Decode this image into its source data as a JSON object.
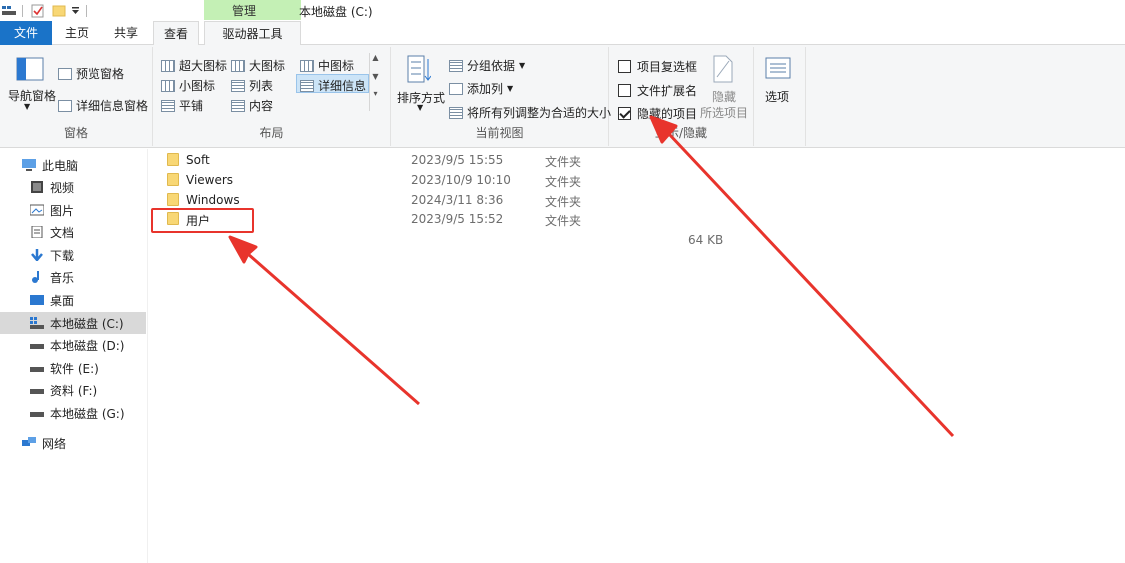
{
  "window": {
    "title": "本地磁盘 (C:)",
    "context_group_label": "管理"
  },
  "tabs": [
    {
      "label": "文件"
    },
    {
      "label": "主页"
    },
    {
      "label": "共享"
    },
    {
      "label": "查看"
    },
    {
      "label": "驱动器工具"
    }
  ],
  "ribbon": {
    "pane_group": {
      "label": "窗格",
      "nav_pane": "导航窗格",
      "preview_pane": "预览窗格",
      "details_pane": "详细信息窗格"
    },
    "layout_group": {
      "label": "布局",
      "items": [
        "超大图标",
        "大图标",
        "中图标",
        "小图标",
        "列表",
        "详细信息",
        "平铺",
        "内容"
      ]
    },
    "view_group": {
      "label": "当前视图",
      "sort_by": "排序方式",
      "group_by": "分组依据",
      "add_column": "添加列",
      "fit_columns": "将所有列调整为合适的大小"
    },
    "showhide_group": {
      "label": "显示/隐藏",
      "item_checkboxes": {
        "label": "项目复选框",
        "checked": false
      },
      "file_extensions": {
        "label": "文件扩展名",
        "checked": false
      },
      "hidden_items": {
        "label": "隐藏的项目",
        "checked": true
      },
      "hide_selected_line1": "隐藏",
      "hide_selected_line2": "所选项目"
    },
    "options": {
      "label": "选项"
    }
  },
  "nav": {
    "items": [
      {
        "label": "此电脑"
      },
      {
        "label": "视频"
      },
      {
        "label": "图片"
      },
      {
        "label": "文档"
      },
      {
        "label": "下载"
      },
      {
        "label": "音乐"
      },
      {
        "label": "桌面"
      },
      {
        "label": "本地磁盘 (C:)"
      },
      {
        "label": "本地磁盘 (D:)"
      },
      {
        "label": "软件 (E:)"
      },
      {
        "label": "资料 (F:)"
      },
      {
        "label": "本地磁盘 (G:)"
      },
      {
        "label": "网络"
      }
    ]
  },
  "files": [
    {
      "name": "Soft",
      "date": "2023/9/5 15:55",
      "type": "文件夹"
    },
    {
      "name": "Viewers",
      "date": "2023/10/9 10:10",
      "type": "文件夹"
    },
    {
      "name": "Windows",
      "date": "2024/3/11 8:36",
      "type": "文件夹"
    },
    {
      "name": "用户",
      "date": "2023/9/5 15:52",
      "type": "文件夹"
    }
  ],
  "extra_size": "64 KB",
  "colors": {
    "accent": "#1a73c8",
    "context_tab": "#c4f0b5",
    "annotation": "#e8342c"
  }
}
